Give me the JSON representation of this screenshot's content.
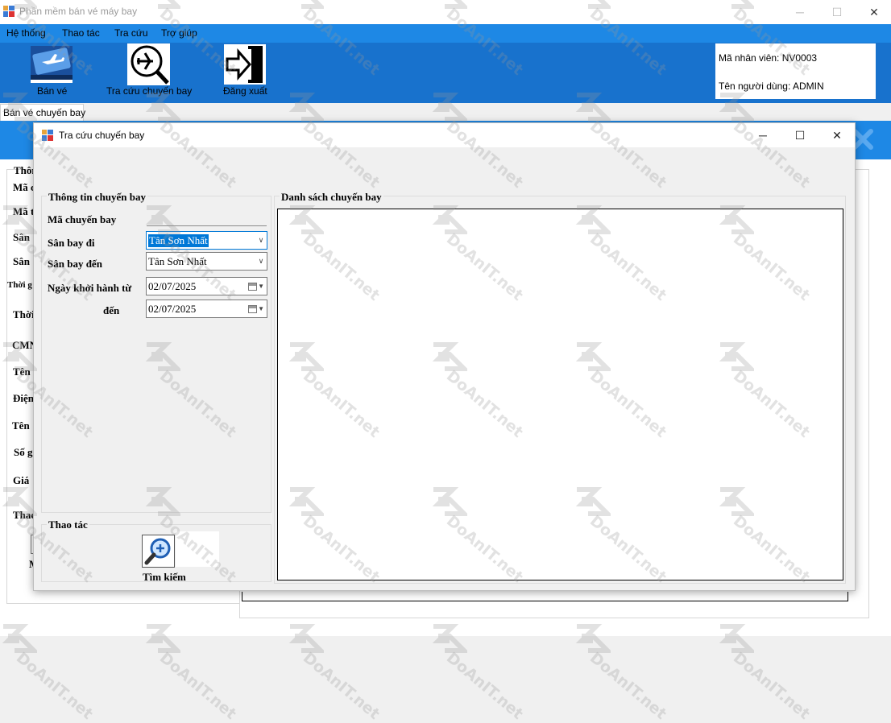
{
  "app": {
    "title": "Phần mềm bán vé máy bay",
    "minimize": "─",
    "maximize": "☐",
    "close": "✕"
  },
  "menu": [
    "Hệ thống",
    "Thao tác",
    "Tra cứu",
    "Trợ giúp"
  ],
  "toolbar": {
    "ban_ve": "Bán vé",
    "tra_cuu": "Tra cứu chuyến bay",
    "dang_xuat": "Đăng xuất"
  },
  "user": {
    "employee_id": "Mã nhân viên: NV0003",
    "username": "Tên người dùng: ADMIN"
  },
  "tab": {
    "label": "Bán vé chuyến bay"
  },
  "background_form": {
    "labels": [
      "Thôn",
      "Mã c",
      "Mã t",
      "Sân",
      "Sân",
      "Thời g",
      "Thời",
      "CMN",
      "Tên",
      "Điện",
      "Tên",
      "Số g",
      "Giá",
      "Thao",
      "M"
    ]
  },
  "dialog": {
    "title": "Tra cứu chuyến bay",
    "minimize": "─",
    "maximize": "☐",
    "close": "✕",
    "info_group": {
      "title": "Thông tin chuyến bay",
      "ma_chuyen_bay": "Mã chuyến bay",
      "san_bay_di": "Sân bay đi",
      "san_bay_di_value": "Tân Sơn Nhất",
      "san_bay_den": "Sân bay đến",
      "san_bay_den_value": "Tân Sơn Nhất",
      "ngay_tu": "Ngày khởi hành từ",
      "ngay_tu_value": "02/07/2025",
      "den": "đến",
      "ngay_den_value": "02/07/2025"
    },
    "list_group": {
      "title": "Danh sách chuyến bay"
    },
    "action_group": {
      "title": "Thao tác",
      "search_button": "Tìm kiếm"
    }
  },
  "watermark": {
    "text": "DoAnIT.net"
  },
  "colors": {
    "menu_blue": "#1e88e5",
    "toolbar_blue": "#1872cd",
    "selection": "#0078d7"
  },
  "icons": [
    "app-icon",
    "ticket-icon",
    "flight-search-icon",
    "logout-icon",
    "calendar-icon",
    "search-zoom-icon",
    "close-x-icon"
  ]
}
